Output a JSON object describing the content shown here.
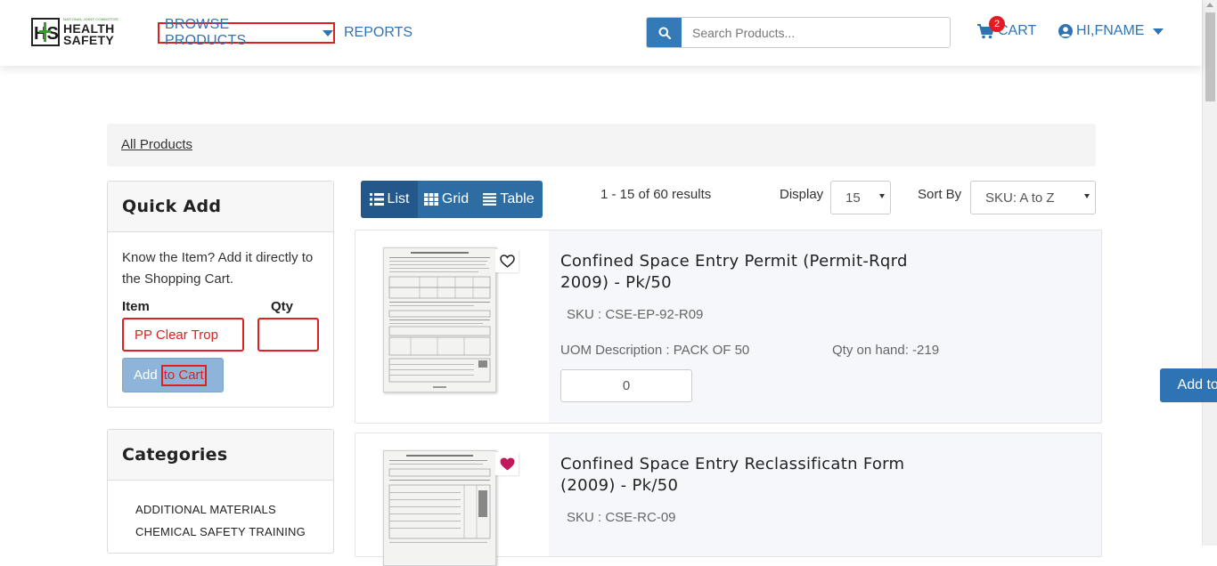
{
  "header": {
    "logo": {
      "tagline": "NATIONAL JOINT COMMITTEE",
      "line1": "HEALTH",
      "line2": "SAFETY",
      "mark": "HS"
    },
    "nav": {
      "browse_label": "BROWSE PRODUCTS",
      "reports_label": "REPORTS"
    },
    "search": {
      "placeholder": "Search Products..."
    },
    "cart": {
      "label": "CART",
      "count": "2"
    },
    "user": {
      "label": "HI,FNAME"
    }
  },
  "breadcrumb": {
    "label": "All Products"
  },
  "quick_add": {
    "title": "Quick Add",
    "description": "Know the Item? Add it directly to the Shopping Cart.",
    "item_label": "Item",
    "qty_label": "Qty",
    "item_value": "PP Clear Trop",
    "qty_value": "",
    "button_label_start": "Add",
    "button_label_end": "to Cart"
  },
  "categories": {
    "title": "Categories",
    "items": [
      "ADDITIONAL MATERIALS",
      "CHEMICAL SAFETY TRAINING"
    ]
  },
  "toolbar": {
    "views": [
      "List",
      "Grid",
      "Table"
    ],
    "active_view": "List",
    "results": "1 - 15 of 60 results",
    "display_label": "Display",
    "display_value": "15",
    "sort_label": "Sort By",
    "sort_value": "SKU: A to Z"
  },
  "products": [
    {
      "title": "Confined Space Entry Permit (Permit-Rqrd 2009) - Pk/50",
      "sku": "SKU : CSE-EP-92-R09",
      "uom": "UOM Description : PACK OF 50",
      "qoh": "Qty on hand: -219",
      "qty": "0",
      "add_label": "Add to Cart",
      "favorite": false
    },
    {
      "title": "Confined Space Entry Reclassificatn Form (2009) - Pk/50",
      "sku": "SKU : CSE-RC-09",
      "favorite": true
    }
  ],
  "colors": {
    "accent": "#2e74b5",
    "highlight": "#e0201f",
    "favorite": "#c2185b"
  }
}
